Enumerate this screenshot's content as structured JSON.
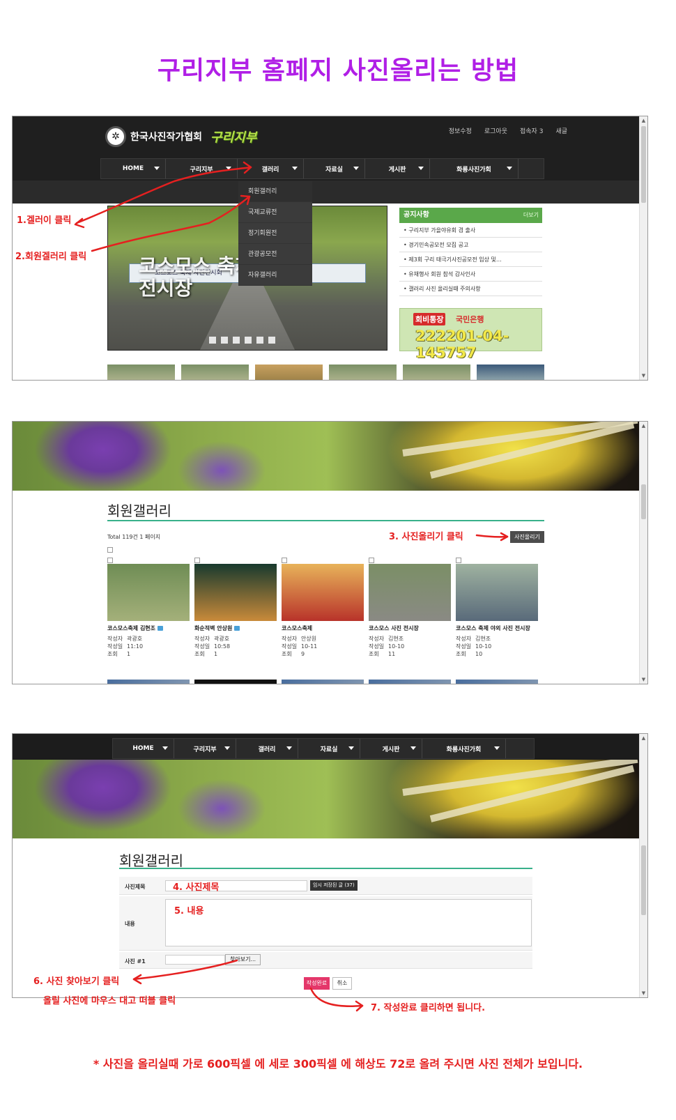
{
  "title": "구리지부 홈페지 사진올리는 방법",
  "step1_screen": {
    "logo": "한국사진작가협회",
    "logo_branch": "구리지부",
    "top_links": [
      "정보수정",
      "로그아웃",
      "접속자 3",
      "새글"
    ],
    "menu": [
      "HOME",
      "구리지부",
      "갤러리",
      "자료실",
      "게시판",
      "화룡사진가회"
    ],
    "gallery_dropdown": [
      "회원갤러리",
      "국제교류전",
      "정기회원전",
      "관광공모전",
      "자유갤러리"
    ],
    "slide_text": "코스모스 축제\n전시장",
    "slide_banner": "코스모스 축제 사진전시회",
    "notice": {
      "title": "공지사항",
      "more": "더보기",
      "items": [
        "• 구리지부 가을야유회 겸 출사",
        "• 경기민속공모전 모집 공고",
        "• 제3회 구리 태극기사진공모전 입상 및…",
        "• 유채행사 회원 참석 감사인사",
        "• 갤러리 사진 올리실때 주의사항"
      ]
    },
    "account": {
      "tag": "회비통장",
      "bank": "국민은행",
      "number": "222201-04-145757"
    },
    "annotation_1": "1.겔러이 클릭",
    "annotation_2": "2.회원겔러리 클릭"
  },
  "step2_screen": {
    "section_title": "회원갤러리",
    "total": "Total 119건 1 페이지",
    "upload_button": "사진올리기",
    "annotation_3": "3. 사진올리기 클릭",
    "meta_labels": {
      "author": "작성자",
      "date": "작성일",
      "views": "조회"
    },
    "posts": [
      {
        "title": "코스모스축제 김현조",
        "author": "곽광호",
        "date": "11:10",
        "views": "1",
        "comment": true,
        "colors": [
          "#6f8d55",
          "#a4b07a"
        ]
      },
      {
        "title": "화순적벽 안상원",
        "author": "곽광호",
        "date": "10:58",
        "views": "1",
        "comment": true,
        "colors": [
          "#183a2e",
          "#c98a3a"
        ]
      },
      {
        "title": "코스모스축제",
        "author": "안상원",
        "date": "10-11",
        "views": "9",
        "comment": false,
        "colors": [
          "#e8b35a",
          "#b8332a"
        ]
      },
      {
        "title": "코스모스 사진 전시장",
        "author": "김현조",
        "date": "10-10",
        "views": "11",
        "comment": false,
        "colors": [
          "#7b8f66",
          "#8a8a84"
        ]
      },
      {
        "title": "코스모스 축제 야외 사진 전시장",
        "author": "김현조",
        "date": "10-10",
        "views": "10",
        "comment": false,
        "colors": [
          "#9fb2a0",
          "#596a7a"
        ]
      }
    ]
  },
  "step3_screen": {
    "menu": [
      "HOME",
      "구리지부",
      "갤러리",
      "자료실",
      "게시판",
      "화룡사진가회"
    ],
    "section_title": "회원갤러리",
    "labels": {
      "title": "사진제목",
      "content": "내용",
      "photo": "사진 #1"
    },
    "temp_saved": "임시 저장된 글 (37)",
    "browse_button": "찾아보기...",
    "submit_button": "작성완료",
    "cancel_button": "취소",
    "annotation_4": "4. 사진제목",
    "annotation_5": "5. 내용",
    "annotation_6": "6. 사진 찾아보기 클릭",
    "annotation_6b": "올릴 사진에 마우스 대고 떠블 클릭",
    "annotation_7": "7. 작성완료 클리하면 됩니다."
  },
  "bottom_note": "* 사진을 올리실때  가로 600픽셀  에  세로 300픽셀 에 해상도 72로 올려 주시면 사진 전체가 보입니다."
}
